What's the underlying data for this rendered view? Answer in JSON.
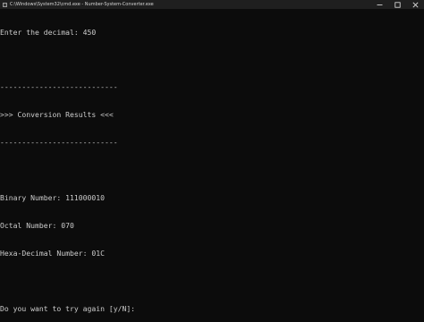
{
  "window": {
    "title": "C:\\Windows\\System32\\cmd.exe - Number-System-Converter.exe",
    "minimize_glyph": "—",
    "maximize_glyph": "☐",
    "close_glyph": "✕"
  },
  "console": {
    "lines": [
      "Enter the decimal: 450",
      "",
      "---------------------------",
      ">>> Conversion Results <<<",
      "---------------------------",
      "",
      "Binary Number: 111000010",
      "Octal Number: 070",
      "Hexa-Decimal Number: 01C",
      "",
      "Do you want to try again [y/N]:"
    ]
  },
  "colors": {
    "background": "#0c0c0c",
    "text": "#cccccc",
    "titlebar": "#1f1f1f"
  }
}
